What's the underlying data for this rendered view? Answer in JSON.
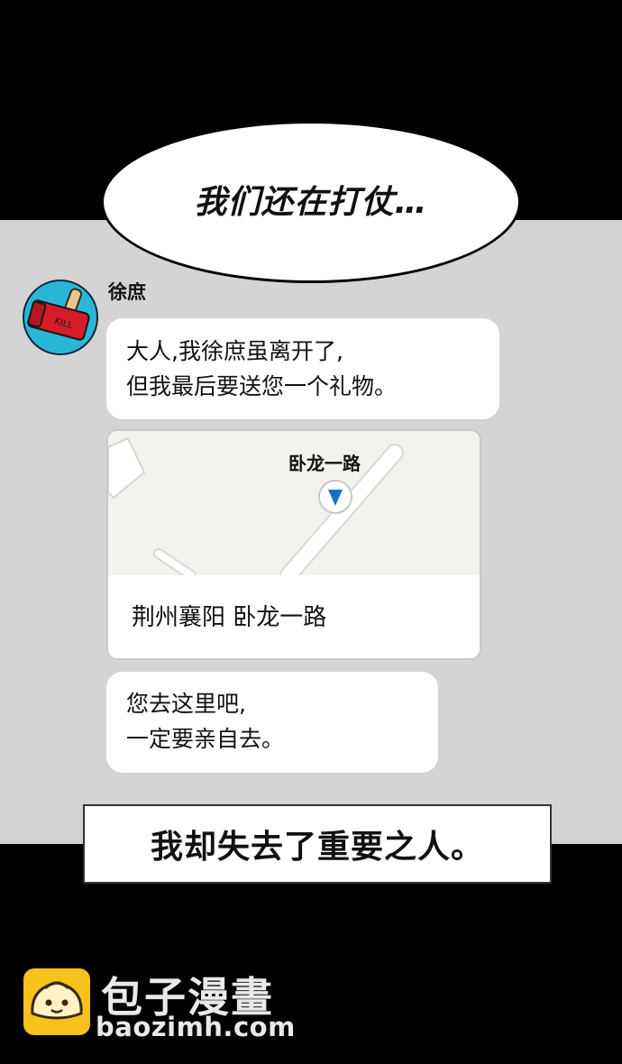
{
  "speech_bubble": {
    "text": "我们还在打仗…"
  },
  "chat": {
    "sender": "徐庶",
    "avatar_icon": "hammer-kill-icon",
    "message1": {
      "line1": "大人,我徐庶虽离开了,",
      "line2": "但我最后要送您一个礼物。"
    },
    "location_card": {
      "road_label": "卧龙一路",
      "address": "荆州襄阳 卧龙一路",
      "pin_icon": "map-pin-icon"
    },
    "message3": {
      "line1": "您去这里吧,",
      "line2": "一定要亲自去。"
    }
  },
  "caption": {
    "text": "我却失去了重要之人。"
  },
  "watermark": {
    "title": "包子漫畫",
    "url": "baozimh.com",
    "logo_icon": "bun-mascot-icon"
  },
  "colors": {
    "panel_gray": "#d4d4d4",
    "avatar_bg": "#2ab6d8",
    "pin_blue": "#1a72c4",
    "logo_yellow": "#f6c21c"
  }
}
